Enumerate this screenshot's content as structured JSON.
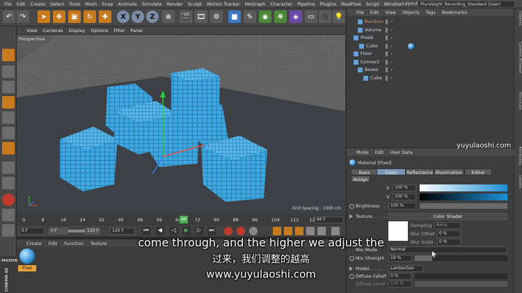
{
  "menu": [
    "File",
    "Edit",
    "Create",
    "Select",
    "Tools",
    "Mesh",
    "Snap",
    "Animate",
    "Simulate",
    "Render",
    "Sculpt",
    "Motion Tracker",
    "MoGraph",
    "Character",
    "Pipeline",
    "Plugins",
    "RealFlow",
    "Script",
    "Window"
  ],
  "layout": {
    "label": "Layout:",
    "value": "Pluralsight_Recording_Standard (User)"
  },
  "toolbar_axes": [
    "X",
    "Y",
    "Z"
  ],
  "viewport": {
    "menu": [
      "View",
      "Cameras",
      "Display",
      "Options",
      "Filter",
      "Panel"
    ],
    "label": "Perspective",
    "grid_spacing": "Grid Spacing : 1000 cm"
  },
  "timeline": {
    "ticks": [
      "0",
      "8",
      "16",
      "24",
      "32",
      "40",
      "48",
      "56",
      "64",
      "72",
      "80",
      "88",
      "96",
      "104",
      "112",
      "120"
    ],
    "current_frame": "66",
    "frame_field": "66 F"
  },
  "transport": {
    "start": "0 F",
    "start2": "0 F",
    "end": "120 F",
    "end2": "120 F"
  },
  "material_manager": {
    "menu": [
      "Create",
      "Edit",
      "Function",
      "Texture"
    ],
    "material_name": "Pixel"
  },
  "logo": {
    "line1": "MAXON",
    "line2": "CINEMA 4D"
  },
  "objects": {
    "menu": [
      "File",
      "Edit",
      "View",
      "Objects",
      "Tags",
      "Bookmarks"
    ],
    "items": [
      {
        "name": "Random",
        "color": "#ff8a3d"
      },
      {
        "name": "Volume",
        "color": "#cfd9e8"
      },
      {
        "name": "Pixels",
        "color": "#cfd9e8"
      },
      {
        "name": "Cube",
        "color": "#cfd9e8"
      },
      {
        "name": "Floor",
        "color": "#cfd9e8"
      },
      {
        "name": "Connect",
        "color": "#cfd9e8"
      },
      {
        "name": "Boxes",
        "color": "#cfd9e8"
      },
      {
        "name": "Cube",
        "color": "#cfd9e8"
      }
    ]
  },
  "attributes": {
    "menu": [
      "Mode",
      "Edit",
      "User Data"
    ],
    "title": "Material [Pixel]",
    "tabs": [
      "Basic",
      "Color",
      "Reflectance",
      "Illumination",
      "Editor",
      "Assign"
    ],
    "active_tab": "Color",
    "s_label": "S",
    "s_value": "100 %",
    "v_label": "V",
    "v_value": "100 %",
    "brightness_label": "Brightness . . .",
    "brightness_value": "100 %",
    "texture_label": "Texture. . . . . .",
    "texture_value": "Color Shader",
    "sampling_label": "Sampling",
    "sampling_value": "None",
    "blur_offset_label": "Blur Offset",
    "blur_offset_value": "0 %",
    "blur_scale_label": "Blur Scale",
    "blur_scale_value": "0 %",
    "mix_mode_label": "Mix Mode",
    "mix_mode_value": "Normal",
    "mix_strength_label": "Mix Strength",
    "mix_strength_value": "19 %",
    "model_label": "Model. . . . .",
    "model_value": "Lambertian",
    "diffuse_falloff_label": "Diffuse Falloff",
    "diffuse_falloff_value": "0 %",
    "diffuse_level_label": "Diffuse Level",
    "diffuse_level_value": "100 %"
  },
  "side_tabs": [
    "Objects",
    "Content Browser",
    "Structure",
    "Attributes",
    "Layers"
  ],
  "watermark_top": "yuyulaoshi.com",
  "subtitles": {
    "english": "come through, and the higher we adjust the",
    "chinese": "过来，我们调整的越高",
    "site": "www.yuyulaoshi.com"
  }
}
